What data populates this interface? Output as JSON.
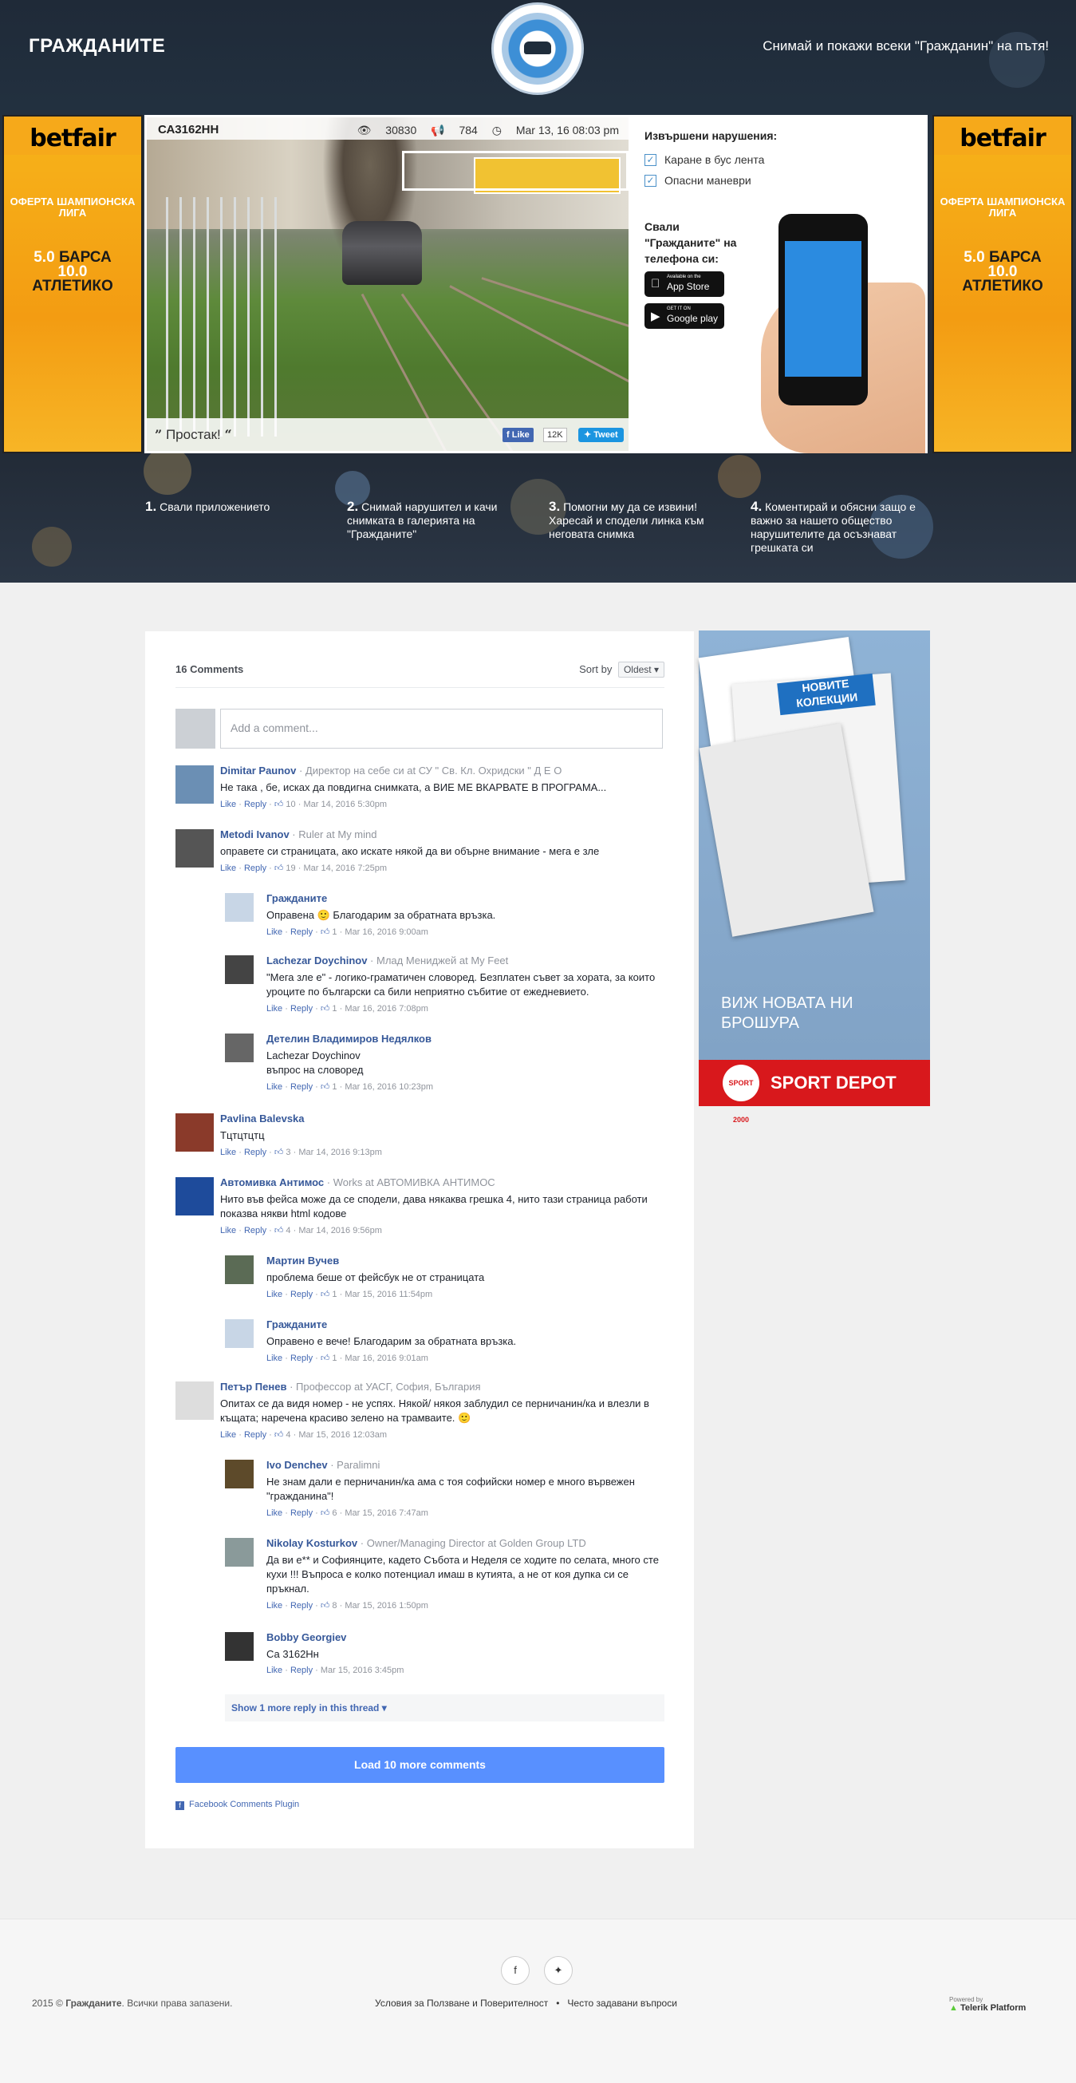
{
  "header": {
    "title": "ГРАЖДАНИТЕ",
    "tagline": "Снимай и покажи всеки \"Гражданин\" на пътя!"
  },
  "side_ads": {
    "brand": "betfair",
    "offer": "ОФЕРТА ШАМПИОНСКА ЛИГА",
    "odds_line1_num": "5.0",
    "odds_line1_team": "БАРСА",
    "odds_line2_num": "10.0",
    "odds_line3_team": "АТЛЕТИКО"
  },
  "feature": {
    "plate": "СА3162НН",
    "views": "30830",
    "shares": "784",
    "date": "Mar 13, 16 08:03 pm",
    "caption": "Простак!",
    "fb_like": "Like",
    "fb_count": "12K",
    "tweet": "Tweet",
    "violations_title": "Извършени нарушения:",
    "violations": [
      "Каране в бус лента",
      "Опасни маневри"
    ],
    "download_title": "Свали \"Гражданите\" на телефона си:",
    "appstore_small": "Available on the",
    "appstore": "App Store",
    "googleplay_small": "GET IT ON",
    "googleplay": "Google play"
  },
  "steps": [
    {
      "num": "1.",
      "text": "Свали приложението"
    },
    {
      "num": "2.",
      "text": "Снимай нарушител и качи снимката в галерията на \"Гражданите\""
    },
    {
      "num": "3.",
      "text": "Помогни му да се извини! Харесай и сподели линка към неговата снимка"
    },
    {
      "num": "4.",
      "text": "Коментирай и обясни защо е важно за нашето общество нарушителите да осъзнават грешката си"
    }
  ],
  "comments_panel": {
    "count_label": "16 Comments",
    "sort_label": "Sort by",
    "sort_value": "Oldest",
    "add_placeholder": "Add a comment...",
    "show_more": "Show 1 more reply in this thread",
    "load_more": "Load 10 more comments",
    "plugin": "Facebook Comments Plugin",
    "like": "Like",
    "reply": "Reply"
  },
  "comments": [
    {
      "name": "Dimitar Paunov",
      "meta": "Директор на себе си at СУ \" Св. Кл. Охридски \" Д Е О",
      "text": "Не така , бе, исках да повдигна снимката, а ВИЕ МЕ ВКАРВАТЕ В ПРОГРАМА...",
      "likes": "10",
      "date": "Mar 14, 2016 5:30pm"
    },
    {
      "name": "Metodi Ivanov",
      "meta": "Ruler at My mind",
      "text": "оправете си страницата, ако искате някой да ви обърне внимание - мега е зле",
      "likes": "19",
      "date": "Mar 14, 2016 7:25pm"
    },
    {
      "name": "Гражданите",
      "meta": "",
      "text": "Оправена 🙂 Благодарим за обратната връзка.",
      "likes": "1",
      "date": "Mar 16, 2016 9:00am"
    },
    {
      "name": "Lachezar Doychinov",
      "meta": "Млад Мениджей at My Feet",
      "text": "\"Мега зле е\" - логико-граматичен словоред. Безплатен съвет за хората, за които уроците по български са били неприятно събитие от ежедневието.",
      "likes": "1",
      "date": "Mar 16, 2016 7:08pm"
    },
    {
      "name": "Детелин Владимиров Недялков",
      "meta": "",
      "text": "Lachezar Doychinov\nвъпрос на словоред",
      "likes": "1",
      "date": "Mar 16, 2016 10:23pm"
    },
    {
      "name": "Pavlina Balevska",
      "meta": "",
      "text": "Тцтцтцтц",
      "likes": "3",
      "date": "Mar 14, 2016 9:13pm"
    },
    {
      "name": "Автомивка Антимос",
      "meta": "Works at АВТОМИВКА АНТИМОС",
      "text": "Нито във фейса може да се сподели, дава някаква грешка 4, нито тази страница работи показва някви html кодове",
      "likes": "4",
      "date": "Mar 14, 2016 9:56pm"
    },
    {
      "name": "Мартин Вучев",
      "meta": "",
      "text": "проблема беше от фейсбук не от страницата",
      "likes": "1",
      "date": "Mar 15, 2016 11:54pm"
    },
    {
      "name": "Гражданите",
      "meta": "",
      "text": "Оправено е вече! Благодарим за обратната връзка.",
      "likes": "1",
      "date": "Mar 16, 2016 9:01am"
    },
    {
      "name": "Петър Пенев",
      "meta": "Профессор at УАСГ, София, България",
      "text": "Опитах се да видя номер - не успях. Някой/ някоя заблудил се перничанин/ка и влезли в къщата; наречена красиво зелено на трамваите. 🙂",
      "likes": "4",
      "date": "Mar 15, 2016 12:03am"
    },
    {
      "name": "Ivo Denchev",
      "meta": "Paralimni",
      "text": "Не знам дали е перничанин/ка ама с тоя софийски номер е много вървежен \"гражданина\"!",
      "likes": "6",
      "date": "Mar 15, 2016 7:47am"
    },
    {
      "name": "Nikolay Kosturkov",
      "meta": "Owner/Managing Director at Golden Group LTD",
      "text": "Да ви е** и Софиянците, кадето Събота и Неделя се ходите по селата, много сте кухи !!! Въпроса е колко потенциал имаш в кутията, а не от коя дупка си се пръкнал.",
      "likes": "8",
      "date": "Mar 15, 2016 1:50pm"
    },
    {
      "name": "Bobby Georgiev",
      "meta": "",
      "text": "Са 3162Нн",
      "likes": "",
      "date": "Mar 15, 2016 3:45pm"
    }
  ],
  "right_ad": {
    "headline": "НОВИТЕ КОЛЕКЦИИ",
    "see_new_line1": "ВИЖ НОВАТА НИ",
    "see_new_line2": "БРОШУРА",
    "brand": "SPORT DEPOT",
    "badge": "SPORT 2000"
  },
  "footer": {
    "copyright_prefix": "2015 ©",
    "copyright_brand": "Гражданите",
    "copyright_suffix": ". Всички права запазени.",
    "terms": "Условия за Ползване и Поверителност",
    "faq": "Често задавани въпроси",
    "powered": "Powered by",
    "telerik": "Telerik Platform"
  },
  "colors": {
    "accent": "#365899",
    "load_more": "#5890ff",
    "betfair": "#f39c12",
    "sportdepot": "#d8181c"
  }
}
